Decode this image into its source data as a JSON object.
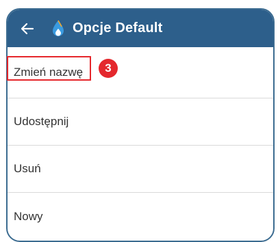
{
  "header": {
    "back_icon": "arrow-left-icon",
    "logo_icon": "water-drop-icon",
    "title": "Opcje Default",
    "background": "#2d5f8b"
  },
  "menu": {
    "items": [
      {
        "label": "Zmień nazwę"
      },
      {
        "label": "Udostępnij"
      },
      {
        "label": "Usuń"
      },
      {
        "label": "Nowy"
      }
    ]
  },
  "annotation": {
    "step_number": "3",
    "highlight_color": "#e5262b"
  }
}
